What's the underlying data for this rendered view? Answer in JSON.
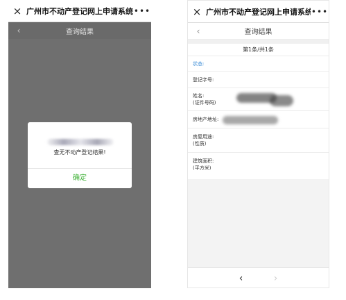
{
  "left_phone": {
    "title": "广州市不动产登记网上申请系统",
    "close_icon": "×",
    "more_icon": "•••",
    "back_icon": "‹",
    "subtitle": "查询结果",
    "dialog": {
      "message": "查无不动产登记结果!",
      "ok_label": "确定"
    }
  },
  "right_phone": {
    "title": "广州市不动产登记网上申请系统",
    "close_icon": "×",
    "more_icon": "•••",
    "back_icon": "‹",
    "subtitle": "查询结果",
    "page_count": "第1条/共1条",
    "fields": {
      "status": "状态:",
      "reg_no": "登记字号:",
      "name_1": "姓名:",
      "name_2": "(证件号码)",
      "address": "房地产地址:",
      "usage_1": "房屋用途:",
      "usage_2": "(性质)",
      "area_1": "建筑面积:",
      "area_2": "(平方米)"
    },
    "prev_icon": "‹",
    "next_icon": "›"
  },
  "colors": {
    "accent_green": "#3cb034",
    "status_blue": "#3a8bd6",
    "mask_gray": "#6f6f6f"
  }
}
